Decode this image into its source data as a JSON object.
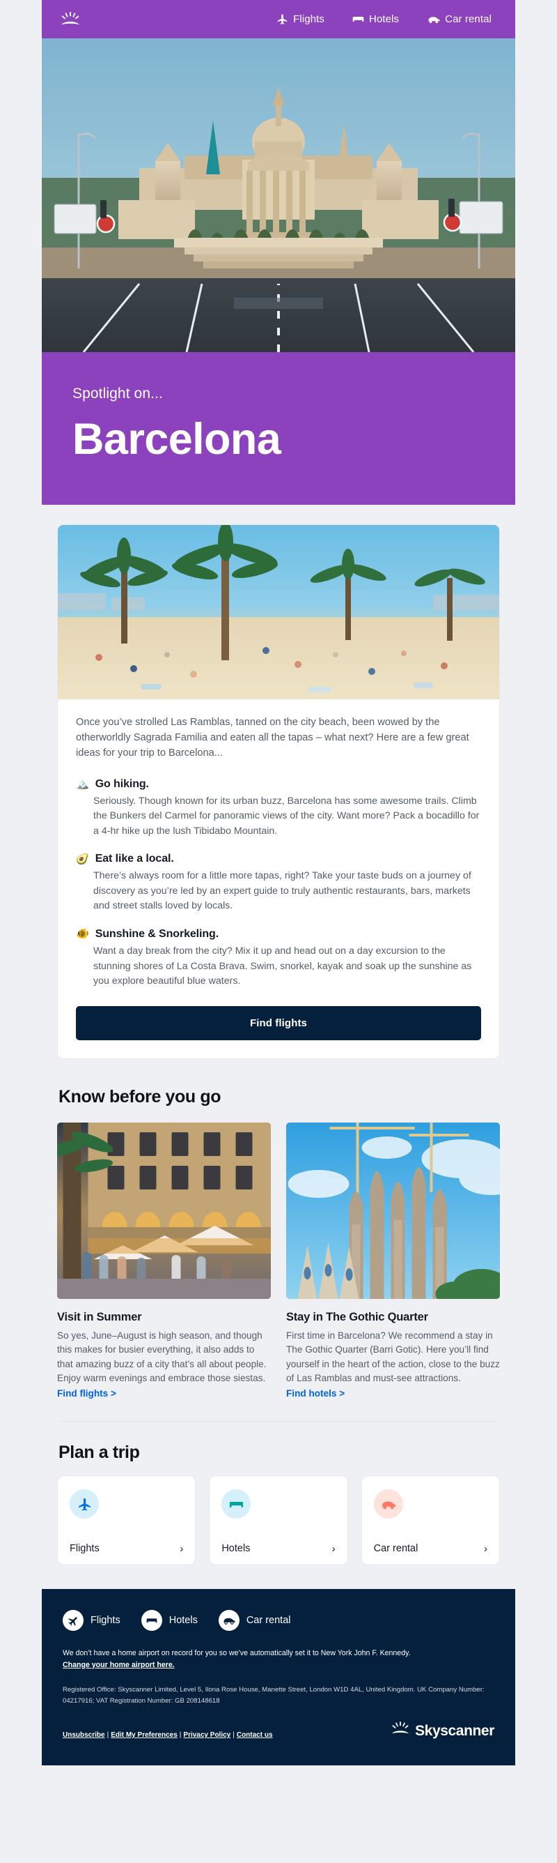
{
  "colors": {
    "purple": "#8b42bc",
    "navy": "#05203c",
    "link_blue": "#0062e3",
    "page_bg": "#eff0f4"
  },
  "nav": {
    "logo_icon": "skyscanner-sunburst-icon",
    "links": [
      {
        "label": "Flights",
        "icon": "airplane-icon"
      },
      {
        "label": "Hotels",
        "icon": "bed-icon"
      },
      {
        "label": "Car rental",
        "icon": "car-icon"
      }
    ]
  },
  "hero": {
    "image_alt": "Palau Nacional Barcelona at dusk with empty road",
    "kicker": "Spotlight on...",
    "title": "Barcelona"
  },
  "article": {
    "image_alt": "Barcelona beach with palm trees and sunbathers",
    "intro": "Once you’ve strolled Las Ramblas, tanned on the city beach, been wowed by the otherworldly Sagrada Familia and eaten all the tapas – what next? Here are a few great ideas for your trip to Barcelona...",
    "tips": [
      {
        "emoji": "🏔️",
        "icon": "mountain-icon",
        "title": "Go hiking.",
        "text": "Seriously. Though known for its urban buzz, Barcelona has some awesome trails. Climb the Bunkers del Carmel for panoramic views of the city. Want more? Pack a bocadillo for a 4-hr hike up the lush Tibidabo Mountain."
      },
      {
        "emoji": "🥑",
        "icon": "avocado-icon",
        "title": "Eat like a local.",
        "text": "There’s always room for a little more tapas, right? Take your taste buds on a journey of discovery as you’re led by an expert guide to truly authentic restaurants, bars, markets and street stalls loved by locals."
      },
      {
        "emoji": "🐠",
        "icon": "tropical-fish-icon",
        "title": "Sunshine & Snorkeling.",
        "text": "Want a day break from the city? Mix it up and head out on a day excursion to the stunning shores of La Costa Brava. Swim, snorkel, kayak and soak up the sunshine as you explore beautiful blue waters."
      }
    ],
    "cta_label": "Find flights"
  },
  "know_before": {
    "heading": "Know before you go",
    "cards": [
      {
        "image_alt": "Placa Reial arcades with outdoor restaurant terraces at night",
        "title": "Visit in Summer",
        "text": "So yes, June–August is high season, and though this makes for busier everything, it also adds to that amazing buzz of a city that’s all about people. Enjoy warm evenings and embrace those siestas.",
        "link": "Find flights >"
      },
      {
        "image_alt": "Sagrada Familia spires against blue sky with cranes",
        "title": "Stay in The Gothic Quarter",
        "text": "First time in Barcelona? We recommend a stay in The Gothic Quarter (Barri Gotic). Here you’ll find yourself in the heart of the action, close to the buzz of Las Ramblas and must-see attractions.",
        "link": "Find hotels >"
      }
    ]
  },
  "plan_a_trip": {
    "heading": "Plan a trip",
    "cards": [
      {
        "label": "Flights",
        "icon": "airplane-icon",
        "badge_color": "#d6f0fb",
        "icon_color": "#0770e3"
      },
      {
        "label": "Hotels",
        "icon": "bed-icon",
        "badge_color": "#d6f0fb",
        "icon_color": "#00a698"
      },
      {
        "label": "Car rental",
        "icon": "car-icon",
        "badge_color": "#fde3dc",
        "icon_color": "#ff7663"
      }
    ],
    "chevron": "›"
  },
  "footer": {
    "links": [
      {
        "label": "Flights",
        "icon": "airplane-icon"
      },
      {
        "label": "Hotels",
        "icon": "bed-icon"
      },
      {
        "label": "Car rental",
        "icon": "car-icon"
      }
    ],
    "airport_note": "We don’t have a home airport on record for you so we’ve automatically set it to New York John F. Kennedy.",
    "airport_link": "Change your home airport here.",
    "legal": "Registered Office: Skyscanner Limited, Level 5, Ilona Rose House, Manette Street, London W1D 4AL, United Kingdom. UK Company Number: 04217916; VAT Registration Number: GB 208148618",
    "policy_links": [
      "Unsubscribe",
      "Edit My Preferences",
      "Privacy Policy",
      "Contact us"
    ],
    "policy_separator": "|",
    "brand_name": "Skyscanner",
    "brand_icon": "skyscanner-sunburst-icon"
  }
}
